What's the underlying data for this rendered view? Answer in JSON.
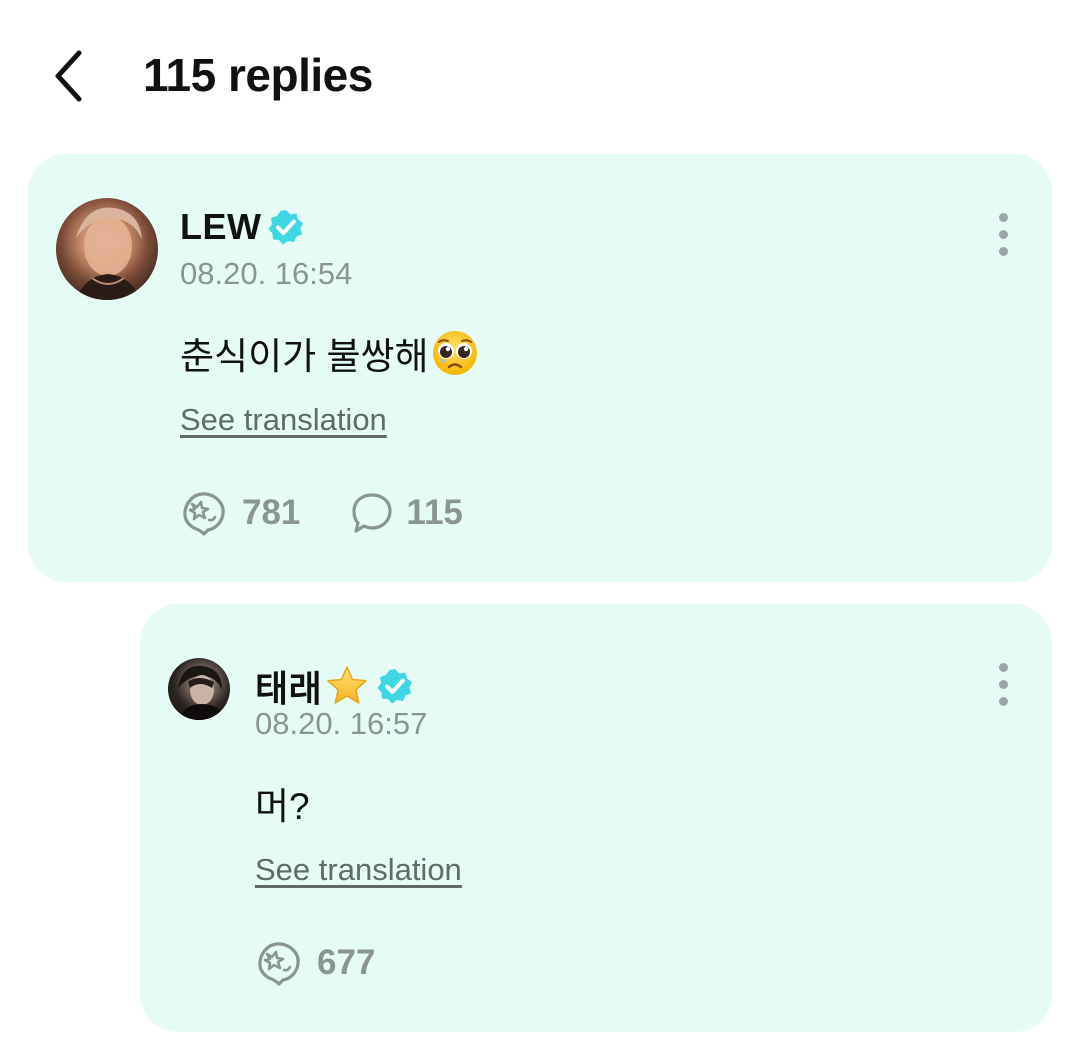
{
  "header": {
    "title": "115 replies",
    "back_icon": "chevron-left-icon"
  },
  "colors": {
    "card_bg": "#e6fbf6",
    "verified": "#3fd7e4",
    "muted": "#8a9493",
    "link": "#5f6a69"
  },
  "post": {
    "author": "LEW",
    "verified": true,
    "timestamp": "08.20. 16:54",
    "text": "춘식이가 불쌍해",
    "text_emoji": "pleading-face-emoji",
    "translate_label": "See translation",
    "like_count": "781",
    "comment_count": "115"
  },
  "reply": {
    "author": "태래",
    "name_emoji": "star-emoji",
    "verified": true,
    "timestamp": "08.20. 16:57",
    "text": "머?",
    "translate_label": "See translation",
    "like_count": "677"
  }
}
